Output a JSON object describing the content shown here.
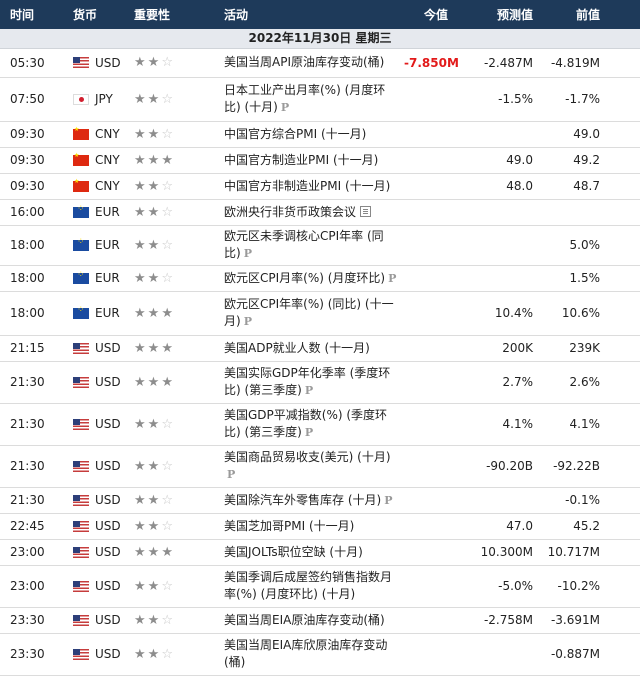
{
  "header": {
    "time": "时间",
    "currency": "货币",
    "importance": "重要性",
    "activity": "活动",
    "actual": "今值",
    "forecast": "预测值",
    "previous": "前值"
  },
  "date_row": "2022年11月30日  星期三",
  "rows": [
    {
      "time": "05:30",
      "flag": "us",
      "currency": "USD",
      "stars": 2,
      "activity": "美国当周API原油库存变动(桶)",
      "p": false,
      "doc": false,
      "actual": "-7.850M",
      "actual_red": true,
      "forecast": "-2.487M",
      "previous": "-4.819M",
      "h": 28
    },
    {
      "time": "07:50",
      "flag": "jp",
      "currency": "JPY",
      "stars": 2,
      "activity": "日本工业产出月率(%) (月度环比) (十月)",
      "p": true,
      "doc": false,
      "actual": "",
      "forecast": "-1.5%",
      "previous": "-1.7%",
      "h": 44
    },
    {
      "time": "09:30",
      "flag": "cn",
      "currency": "CNY",
      "stars": 2,
      "activity": "中国官方综合PMI (十一月)",
      "p": false,
      "doc": false,
      "actual": "",
      "forecast": "",
      "previous": "49.0",
      "h": 26
    },
    {
      "time": "09:30",
      "flag": "cn",
      "currency": "CNY",
      "stars": 3,
      "activity": "中国官方制造业PMI (十一月)",
      "p": false,
      "doc": false,
      "actual": "",
      "forecast": "49.0",
      "previous": "49.2",
      "h": 26
    },
    {
      "time": "09:30",
      "flag": "cn",
      "currency": "CNY",
      "stars": 2,
      "activity": "中国官方非制造业PMI (十一月)",
      "p": false,
      "doc": false,
      "actual": "",
      "forecast": "48.0",
      "previous": "48.7",
      "h": 26
    },
    {
      "time": "16:00",
      "flag": "eu",
      "currency": "EUR",
      "stars": 2,
      "activity": "欧洲央行非货币政策会议",
      "p": false,
      "doc": true,
      "actual": "",
      "forecast": "",
      "previous": "",
      "h": 26
    },
    {
      "time": "18:00",
      "flag": "eu",
      "currency": "EUR",
      "stars": 2,
      "activity": "欧元区未季调核心CPI年率 (同比)",
      "p": true,
      "doc": false,
      "actual": "",
      "forecast": "",
      "previous": "5.0%",
      "h": 40
    },
    {
      "time": "18:00",
      "flag": "eu",
      "currency": "EUR",
      "stars": 2,
      "activity": "欧元区CPI月率(%) (月度环比)",
      "p": true,
      "doc": false,
      "actual": "",
      "forecast": "",
      "previous": "1.5%",
      "h": 26
    },
    {
      "time": "18:00",
      "flag": "eu",
      "currency": "EUR",
      "stars": 3,
      "activity": "欧元区CPI年率(%) (同比) (十一月)",
      "p": true,
      "doc": false,
      "actual": "",
      "forecast": "10.4%",
      "previous": "10.6%",
      "h": 44
    },
    {
      "time": "21:15",
      "flag": "us",
      "currency": "USD",
      "stars": 3,
      "activity": "美国ADP就业人数 (十一月)",
      "p": false,
      "doc": false,
      "actual": "",
      "forecast": "200K",
      "previous": "239K",
      "h": 26
    },
    {
      "time": "21:30",
      "flag": "us",
      "currency": "USD",
      "stars": 3,
      "activity": "美国实际GDP年化季率 (季度环比) (第三季度)",
      "p": true,
      "doc": false,
      "actual": "",
      "forecast": "2.7%",
      "previous": "2.6%",
      "h": 42
    },
    {
      "time": "21:30",
      "flag": "us",
      "currency": "USD",
      "stars": 2,
      "activity": "美国GDP平减指数(%) (季度环比) (第三季度)",
      "p": true,
      "doc": false,
      "actual": "",
      "forecast": "4.1%",
      "previous": "4.1%",
      "h": 42
    },
    {
      "time": "21:30",
      "flag": "us",
      "currency": "USD",
      "stars": 2,
      "activity": "美国商品贸易收支(美元) (十月)",
      "p": true,
      "doc": false,
      "actual": "",
      "forecast": "-90.20B",
      "previous": "-92.22B",
      "h": 42
    },
    {
      "time": "21:30",
      "flag": "us",
      "currency": "USD",
      "stars": 2,
      "activity": "美国除汽车外零售库存 (十月)",
      "p": true,
      "doc": false,
      "actual": "",
      "forecast": "",
      "previous": "-0.1%",
      "h": 26
    },
    {
      "time": "22:45",
      "flag": "us",
      "currency": "USD",
      "stars": 2,
      "activity": "美国芝加哥PMI (十一月)",
      "p": false,
      "doc": false,
      "actual": "",
      "forecast": "47.0",
      "previous": "45.2",
      "h": 26
    },
    {
      "time": "23:00",
      "flag": "us",
      "currency": "USD",
      "stars": 3,
      "activity": "美国JOLTs职位空缺 (十月)",
      "p": false,
      "doc": false,
      "actual": "",
      "forecast": "10.300M",
      "previous": "10.717M",
      "h": 26
    },
    {
      "time": "23:00",
      "flag": "us",
      "currency": "USD",
      "stars": 2,
      "activity": "美国季调后成屋签约销售指数月率(%) (月度环比) (十月)",
      "p": false,
      "doc": false,
      "actual": "",
      "forecast": "-5.0%",
      "previous": "-10.2%",
      "h": 42
    },
    {
      "time": "23:30",
      "flag": "us",
      "currency": "USD",
      "stars": 2,
      "activity": "美国当周EIA原油库存变动(桶)",
      "p": false,
      "doc": false,
      "actual": "",
      "forecast": "-2.758M",
      "previous": "-3.691M",
      "h": 26
    },
    {
      "time": "23:30",
      "flag": "us",
      "currency": "USD",
      "stars": 2,
      "activity": "美国当周EIA库欣原油库存变动(桶)",
      "p": false,
      "doc": false,
      "actual": "",
      "forecast": "",
      "previous": "-0.887M",
      "h": 42
    }
  ]
}
